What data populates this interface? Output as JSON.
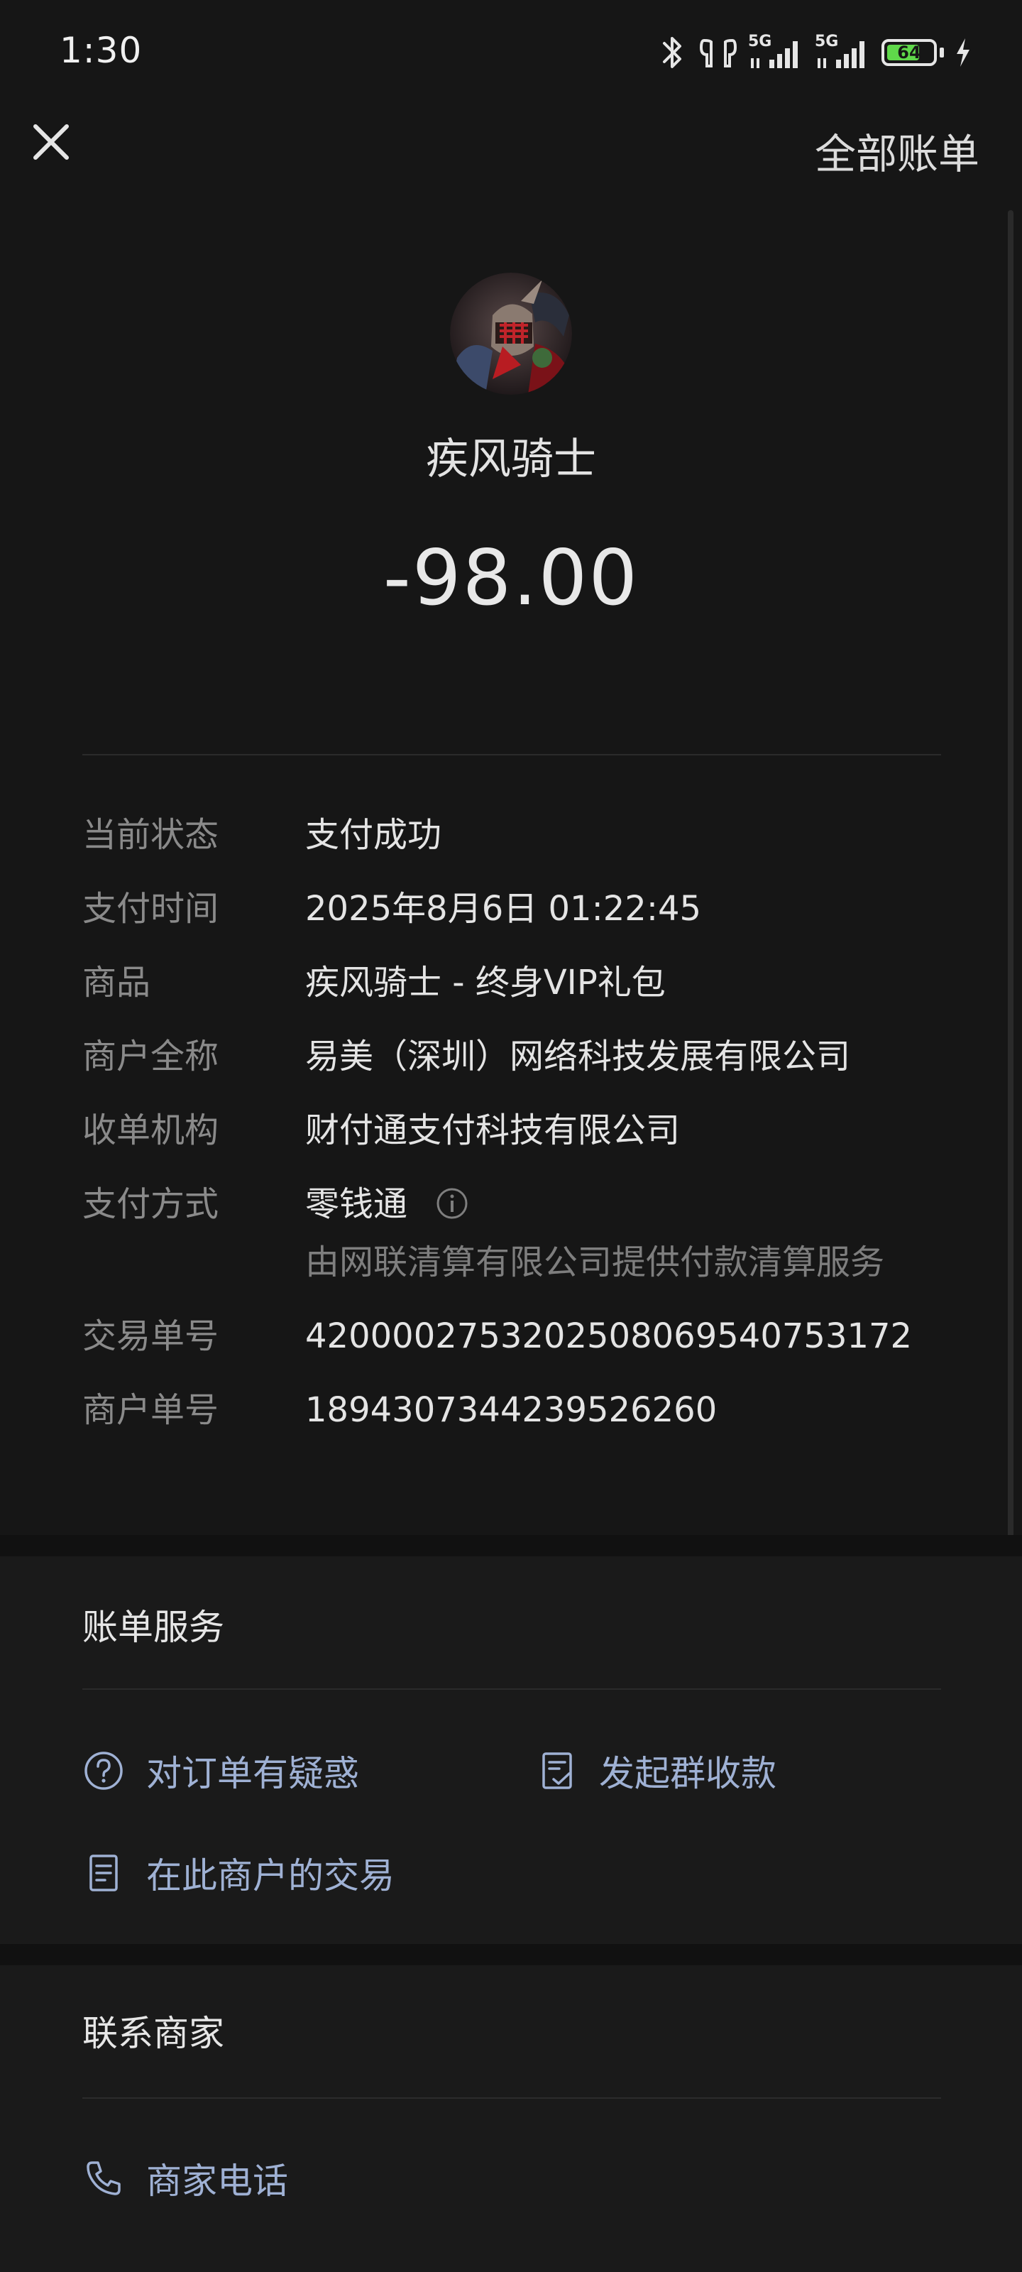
{
  "status_bar": {
    "time": "1:30",
    "network_1": "5G",
    "network_2": "5G",
    "battery_level": "64"
  },
  "nav": {
    "all_bills": "全部账单"
  },
  "header": {
    "merchant_name": "疾风骑士",
    "amount": "-98.00"
  },
  "details": {
    "status_label": "当前状态",
    "status_value": "支付成功",
    "time_label": "支付时间",
    "time_value": "2025年8月6日 01:22:45",
    "product_label": "商品",
    "product_value": "疾风骑士 - 终身VIP礼包",
    "merchant_full_label": "商户全称",
    "merchant_full_value": "易美（深圳）网络科技发展有限公司",
    "acquirer_label": "收单机构",
    "acquirer_value": "财付通支付科技有限公司",
    "payment_method_label": "支付方式",
    "payment_method_value": "零钱通",
    "payment_method_sub": "由网联清算有限公司提供付款清算服务",
    "transaction_no_label": "交易单号",
    "transaction_no_value": "4200002753202508069540753172",
    "merchant_no_label": "商户单号",
    "merchant_no_value": "1894307344239526260"
  },
  "bill_services": {
    "title": "账单服务",
    "items": [
      {
        "label": "对订单有疑惑",
        "icon": "question-circle-icon"
      },
      {
        "label": "发起群收款",
        "icon": "checklist-icon"
      },
      {
        "label": "在此商户的交易",
        "icon": "document-icon"
      }
    ]
  },
  "contact": {
    "title": "联系商家",
    "phone_label": "商家电话",
    "icon": "phone-icon"
  },
  "colors": {
    "background": "#161616",
    "label": "#8a8a8a",
    "value": "#e4e4e4",
    "link": "#9fb1d4",
    "battery": "#5fd84a"
  }
}
